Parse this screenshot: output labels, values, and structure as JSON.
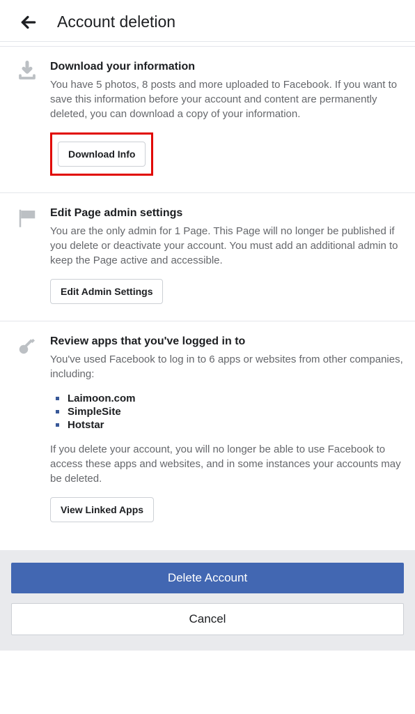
{
  "header": {
    "title": "Account deletion"
  },
  "sections": {
    "download": {
      "title": "Download your information",
      "desc": "You have 5 photos, 8 posts and more uploaded to Facebook. If you want to save this information before your account and content are permanently deleted, you can download a copy of your information.",
      "button": "Download Info"
    },
    "page_admin": {
      "title": "Edit Page admin settings",
      "desc": "You are the only admin for 1 Page. This Page will no longer be published if you delete or deactivate your account. You must add an additional admin to keep the Page active and accessible.",
      "button": "Edit Admin Settings"
    },
    "apps": {
      "title": "Review apps that you've logged in to",
      "desc": "You've used Facebook to log in to 6 apps or websites from other companies, including:",
      "items": [
        "Laimoon.com",
        "SimpleSite",
        "Hotstar"
      ],
      "desc2": "If you delete your account, you will no longer be able to use Facebook to access these apps and websites, and in some instances your accounts may be deleted.",
      "button": "View Linked Apps"
    }
  },
  "footer": {
    "delete": "Delete Account",
    "cancel": "Cancel"
  }
}
